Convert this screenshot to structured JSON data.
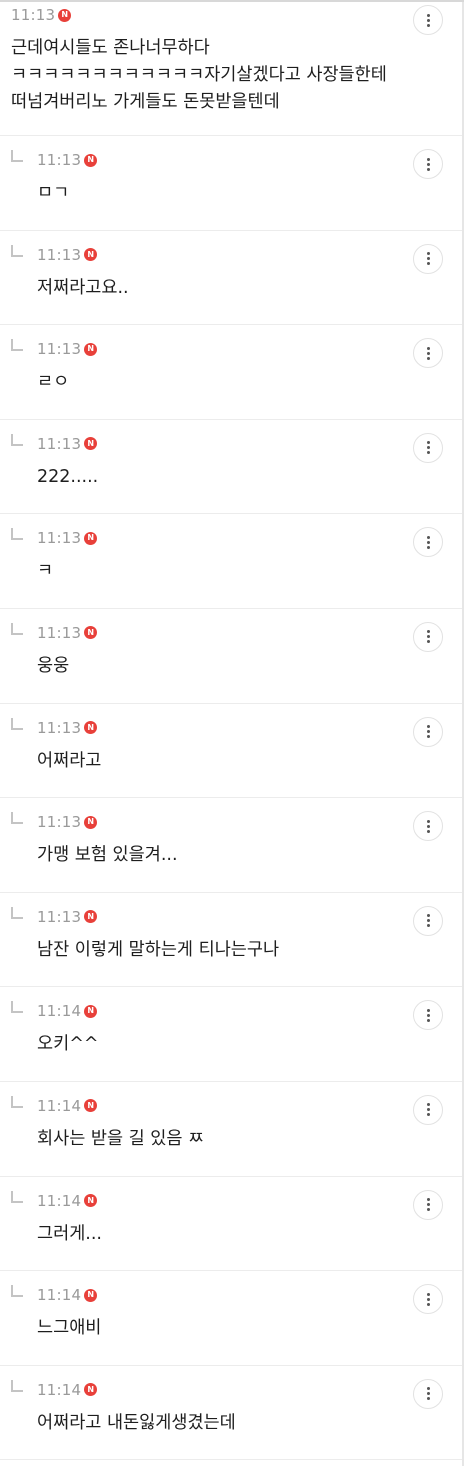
{
  "colors": {
    "new_badge": "#e8403a",
    "time_text": "#9a9a9a",
    "divider": "#ececec"
  },
  "new_badge_label": "N",
  "parent_comment": {
    "time": "11:13",
    "text": "근데여시들도 존나너무하다\nㅋㅋㅋㅋㅋㅋㅋㅋㅋㅋㅋㅋ자기살겠다고 사장들한테\n떠넘겨버리노 가게들도 돈못받을텐데"
  },
  "replies": [
    {
      "time": "11:13",
      "text": "ㅁㄱ"
    },
    {
      "time": "11:13",
      "text": "저쩌라고요.."
    },
    {
      "time": "11:13",
      "text": "ㄹㅇ"
    },
    {
      "time": "11:13",
      "text": "222....."
    },
    {
      "time": "11:13",
      "text": "ㅋ"
    },
    {
      "time": "11:13",
      "text": "웅웅"
    },
    {
      "time": "11:13",
      "text": "어쩌라고"
    },
    {
      "time": "11:13",
      "text": "가맹 보험 있을겨..."
    },
    {
      "time": "11:13",
      "text": "남잔 이렇게 말하는게 티나는구나"
    },
    {
      "time": "11:14",
      "text": "오키^^"
    },
    {
      "time": "11:14",
      "text": "회사는 받을 길 있음 ㅉ"
    },
    {
      "time": "11:14",
      "text": "그러게..."
    },
    {
      "time": "11:14",
      "text": "느그애비"
    },
    {
      "time": "11:14",
      "text": "어쩌라고 내돈잃게생겼는데"
    }
  ]
}
